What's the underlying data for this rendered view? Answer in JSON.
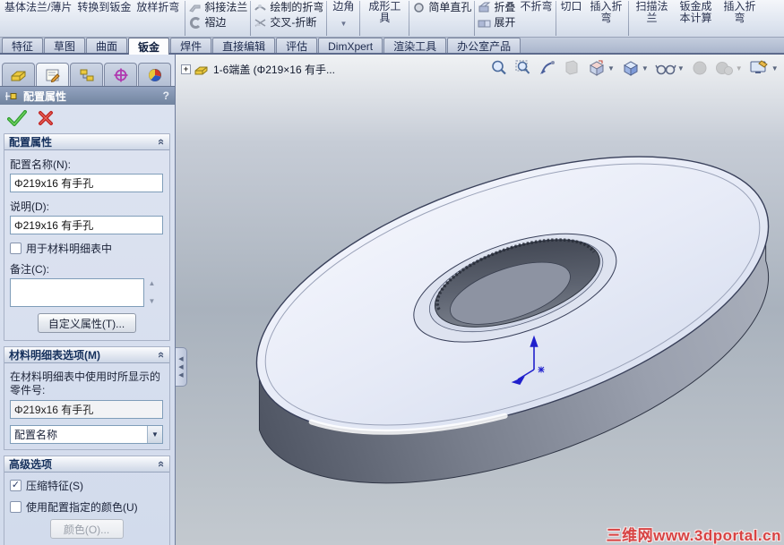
{
  "colors": {
    "accent_header": "#7d90ae",
    "check_green": "#3aa63a",
    "cross_red": "#cc2a2a",
    "part_icon_yellow": "#e9c73f",
    "triad_blue": "#2020cc",
    "watermark_red": "#d84343",
    "viewport_top": "#f0f2f4",
    "viewport_mid": "#a9b2bd",
    "viewport_bottom": "#c3c9cf"
  },
  "ribbon": {
    "base_flange": "基体法兰/薄片",
    "convert_to_sheetmetal": "转换到钣金",
    "lofted_bend": "放样折弯",
    "miter_flange": "斜接法兰",
    "hem": "褶边",
    "sketched_bend": "绘制的折弯",
    "cross_break": "交叉-折断",
    "corners": "边角",
    "forming_tool": "成形工具",
    "simple_hole": "简单直孔",
    "fold": "折叠",
    "unfold": "展开",
    "no_bends": "不折弯",
    "rip": "切口",
    "insert_bends": "插入折弯",
    "swept_flange": "扫描法兰",
    "sheetmetal_cost": "钣金成本计算",
    "insert_bends2": "插入折弯"
  },
  "tabs": {
    "items": [
      {
        "label": "特征"
      },
      {
        "label": "草图"
      },
      {
        "label": "曲面"
      },
      {
        "label": "钣金"
      },
      {
        "label": "焊件"
      },
      {
        "label": "直接编辑"
      },
      {
        "label": "评估"
      },
      {
        "label": "DimXpert"
      },
      {
        "label": "渲染工具"
      },
      {
        "label": "办公室产品"
      }
    ],
    "active": "钣金"
  },
  "tree": {
    "expand_glyph": "+",
    "label": "1-6端盖 (Φ219×16 有手..."
  },
  "panel": {
    "header": {
      "title": "配置属性",
      "help": "?"
    },
    "config": {
      "title": "配置属性",
      "name_label": "配置名称(N):",
      "name_value": "Φ219x16 有手孔",
      "desc_label": "说明(D):",
      "desc_value": "Φ219x16 有手孔",
      "bom_check_label": "用于材料明细表中",
      "remark_label": "备注(C):",
      "remark_value": "",
      "custom_props_button": "自定义属性(T)..."
    },
    "bom": {
      "title": "材料明细表选项(M)",
      "hint": "在材料明细表中使用时所显示的零件号:",
      "part_number": "Φ219x16 有手孔",
      "dropdown_value": "配置名称"
    },
    "advanced": {
      "title": "高级选项",
      "suppress_label": "压缩特征(S)",
      "suppress_checked": "✓",
      "use_color_label": "使用配置指定的颜色(U)",
      "color_button": "颜色(O)..."
    }
  },
  "viewport": {
    "watermark": "三维网www.3dportal.cn"
  },
  "glyphs": {
    "caret_down": "▼",
    "small_caret": "▼",
    "chevron_collapse": "«",
    "up": "▲",
    "down": "▼",
    "left_arrow": "◀"
  }
}
